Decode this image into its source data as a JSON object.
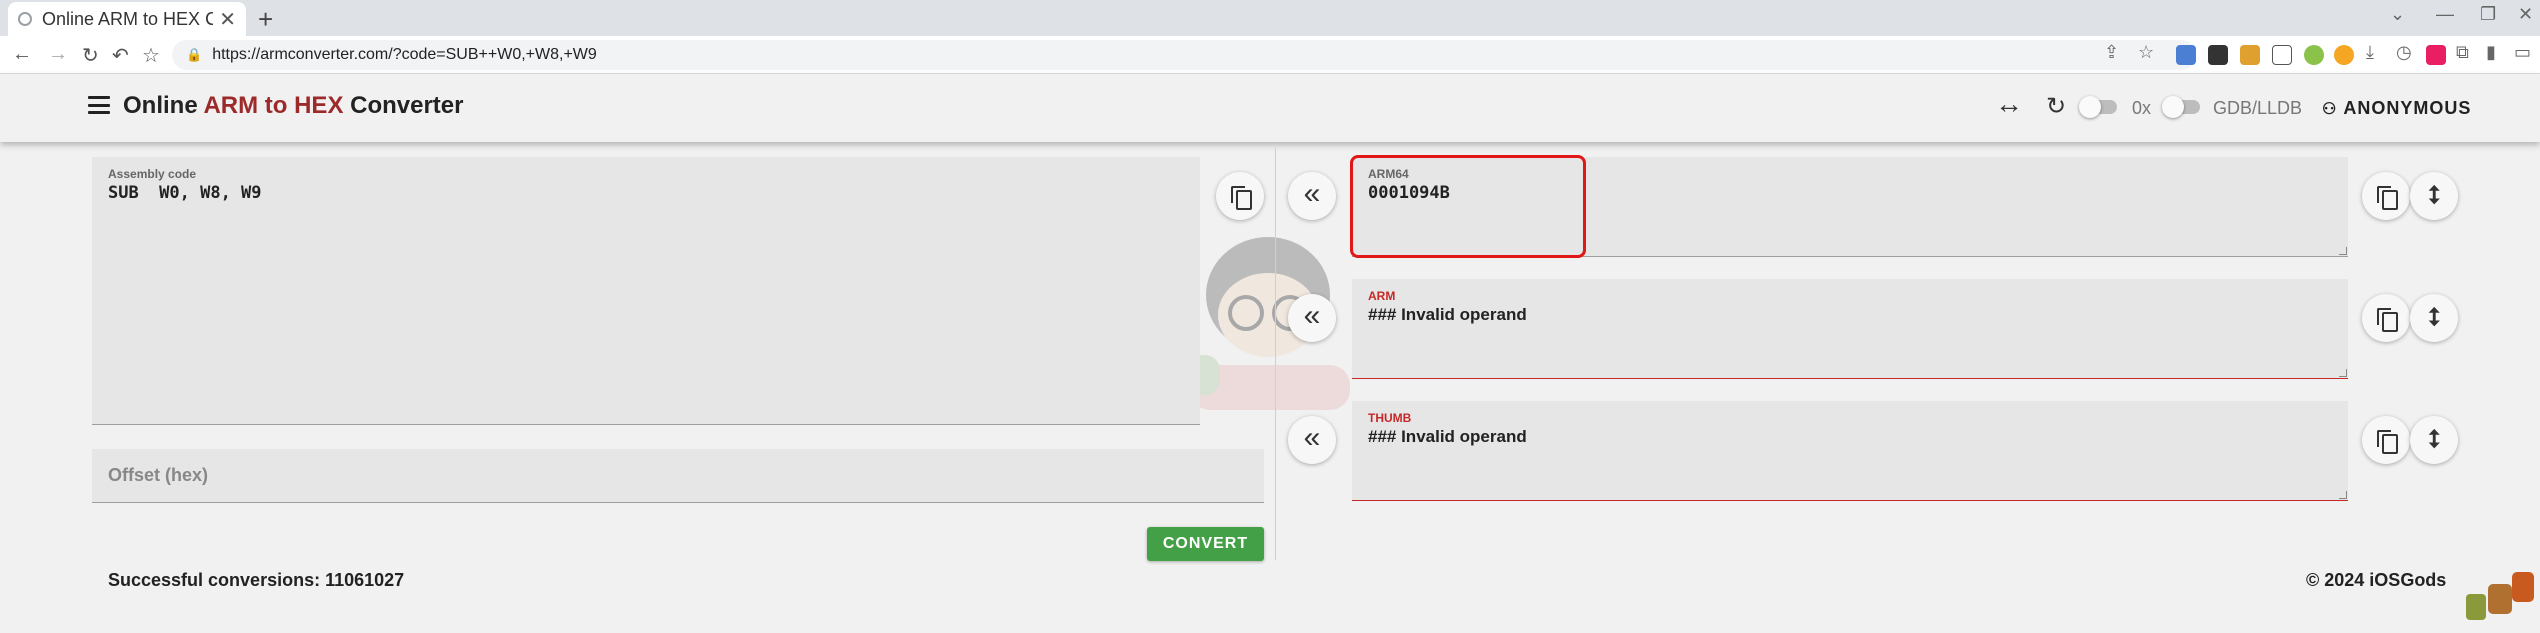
{
  "browser": {
    "tab_title": "Online ARM to HEX Co",
    "url": "https://armconverter.com/?code=SUB++W0,+W8,+W9",
    "new_tab": "+",
    "tab_close": "✕"
  },
  "header": {
    "title_prefix": "Online ",
    "title_accent": "ARM to HEX",
    "title_suffix": " Converter",
    "hex_prefix_label": "0x",
    "debugger_label": "GDB/LLDB",
    "user_label": "ANONYMOUS"
  },
  "input": {
    "assembly_label": "Assembly code",
    "assembly_value": "SUB  W0, W8, W9",
    "offset_placeholder": "Offset (hex)",
    "convert_label": "CONVERT"
  },
  "outputs": [
    {
      "label": "ARM64",
      "value": "0001094B",
      "error": false
    },
    {
      "label": "ARM",
      "value": "### Invalid operand",
      "error": true
    },
    {
      "label": "THUMB",
      "value": "### Invalid operand",
      "error": true
    }
  ],
  "footer": {
    "conversions": "Successful conversions: 11061027",
    "copyright": "© 2024 iOSGods"
  },
  "icons": {
    "swap": "↔",
    "refresh": "↻",
    "chevron": "«",
    "user": "👤"
  },
  "colors": {
    "accent": "#9c2a2a",
    "convert": "#43a047",
    "error": "#c62828",
    "highlight": "#e01818"
  }
}
